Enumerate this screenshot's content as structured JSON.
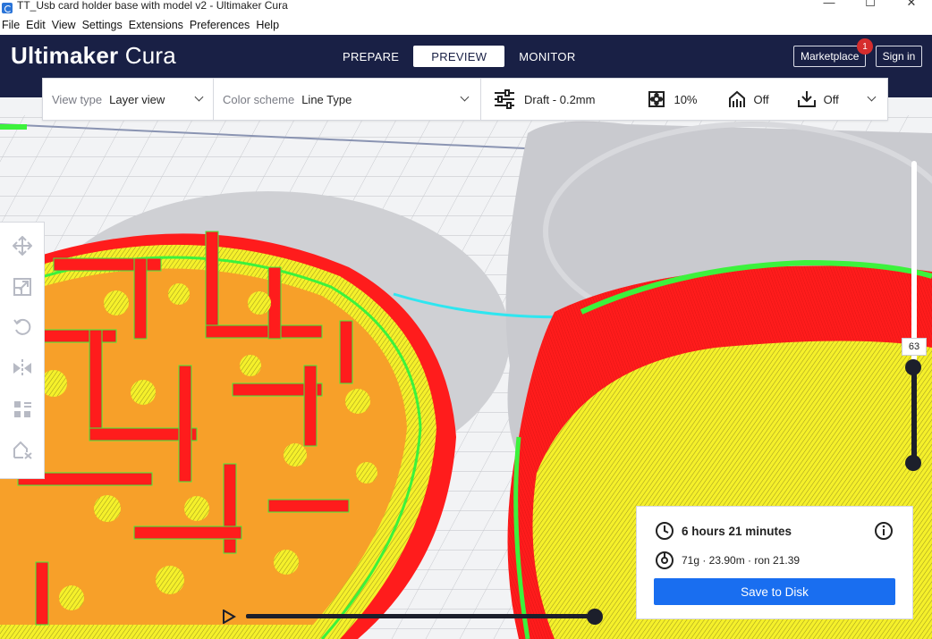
{
  "window": {
    "title": "TT_Usb card holder base with model v2 - Ultimaker Cura",
    "controls": {
      "minimize": "—",
      "maximize": "☐",
      "close": "✕"
    }
  },
  "menubar": {
    "items": [
      {
        "label": "File"
      },
      {
        "label": "Edit"
      },
      {
        "label": "View"
      },
      {
        "label": "Settings"
      },
      {
        "label": "Extensions"
      },
      {
        "label": "Preferences"
      },
      {
        "label": "Help"
      }
    ]
  },
  "header": {
    "logo_bold": "Ultimaker",
    "logo_light": "Cura",
    "tabs": [
      {
        "label": "PREPARE",
        "active": false
      },
      {
        "label": "PREVIEW",
        "active": true
      },
      {
        "label": "MONITOR",
        "active": false
      }
    ],
    "marketplace_label": "Marketplace",
    "marketplace_badge": "1",
    "signin_label": "Sign in",
    "colors": {
      "header_bg": "#192045",
      "badge": "#d62d2d"
    }
  },
  "toolbar": {
    "view_type_label": "View type",
    "view_type_value": "Layer view",
    "color_scheme_label": "Color scheme",
    "color_scheme_value": "Line Type",
    "profile": "Draft - 0.2mm",
    "infill": "10%",
    "support": "Off",
    "adhesion": "Off",
    "icons": {
      "profile": "sliders-icon",
      "infill": "infill-icon",
      "support": "support-icon",
      "adhesion": "adhesion-icon",
      "dropdown": "chevron-down-icon"
    }
  },
  "left_tools": [
    {
      "name": "move-tool",
      "icon": "move-icon"
    },
    {
      "name": "scale-tool",
      "icon": "scale-icon"
    },
    {
      "name": "rotate-tool",
      "icon": "rotate-icon"
    },
    {
      "name": "mirror-tool",
      "icon": "mirror-icon"
    },
    {
      "name": "per-model-settings-tool",
      "icon": "per-model-settings-icon"
    },
    {
      "name": "support-blocker-tool",
      "icon": "support-blocker-icon"
    }
  ],
  "layer_slider": {
    "current_layer": "63",
    "top_fraction": 0.29
  },
  "path_slider": {
    "progress": 1.0
  },
  "print_info": {
    "time": "6 hours 21 minutes",
    "material": "71g · 23.90m · ron 21.39",
    "save_label": "Save to Disk",
    "colors": {
      "save_bg": "#196ef0"
    }
  },
  "model_colors": {
    "wall_outer": "#ff1c1c",
    "wall_inner": "#3cf23c",
    "skin": "#f5f02a",
    "infill": "#f7a029",
    "travel": "#2ee6f0",
    "build_plate": "#f2f3f5"
  }
}
